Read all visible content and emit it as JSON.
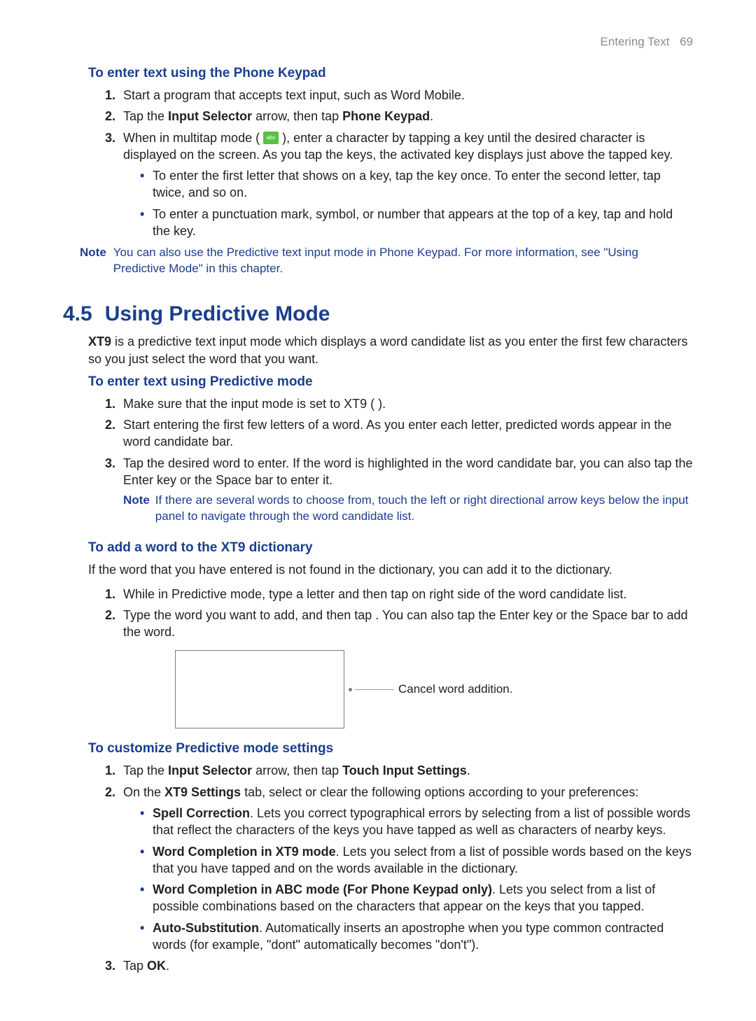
{
  "running_head": {
    "section": "Entering Text",
    "page": "69"
  },
  "sec_phone_keypad": {
    "heading": "To enter text using the Phone Keypad",
    "steps": {
      "s1": "Start a program that accepts text input, such as Word Mobile.",
      "s2_pre": "Tap the ",
      "s2_b1": "Input Selector",
      "s2_mid": " arrow, then tap ",
      "s2_b2": "Phone Keypad",
      "s2_post": ".",
      "s3_pre": "When in multitap mode ( ",
      "s3_post": " ), enter a character by tapping a key until the desired character is displayed on the screen. As you tap the keys, the activated key displays just above the tapped key.",
      "s3_bullets": {
        "b1": "To enter the first letter that shows on a key, tap the key once. To enter the second letter, tap twice, and so on.",
        "b2": "To enter a punctuation mark, symbol, or number that appears at the top of a key, tap and hold the key."
      }
    },
    "note_label": "Note",
    "note_body": "You can also use the Predictive text input mode in Phone Keypad. For more information, see \"Using Predictive Mode\" in this chapter."
  },
  "h45": {
    "num": "4.5",
    "title": "Using Predictive Mode"
  },
  "predictive_intro_pre": "",
  "predictive_intro_b": "XT9",
  "predictive_intro_post": " is a predictive text input mode which displays a word candidate list as you enter the first few characters so you just select the word that you want.",
  "sec_predictive_enter": {
    "heading": "To enter text using Predictive mode",
    "s1": "Make sure that the input mode is set to XT9 (        ).",
    "s2": "Start entering the first few letters of a word. As you enter each letter, predicted words appear in the word candidate bar.",
    "s3": "Tap the desired word to enter. If the word is highlighted in the word candidate bar, you can also tap the Enter key or the Space bar to enter it.",
    "note_label": "Note",
    "note_body": "If there are several words to choose from, touch the left or right directional arrow keys below the input panel to navigate through the word candidate list."
  },
  "sec_add_word": {
    "heading": "To add a word to the XT9 dictionary",
    "intro": "If the word that you have entered is not found in the dictionary, you can add it to the dictionary.",
    "s1": "While in Predictive mode, type a letter and then tap       on right side of the word candidate list.",
    "s2": "Type the word you want to add, and then tap      . You can also tap the Enter key or the Space bar to add the word.",
    "callout": "Cancel word addition."
  },
  "sec_customize": {
    "heading": "To customize Predictive mode settings",
    "s1_pre": "Tap the ",
    "s1_b1": "Input Selector",
    "s1_mid": " arrow, then tap ",
    "s1_b2": "Touch Input Settings",
    "s1_post": ".",
    "s2_pre": "On the ",
    "s2_b": "XT9 Settings",
    "s2_post": " tab, select or clear the following options according to your preferences:",
    "bullets": {
      "b1_b": "Spell Correction",
      "b1_t": ". Lets you correct typographical errors by selecting from a list of possible words that reflect the characters of the keys you have tapped as well as characters of nearby keys.",
      "b2_b": "Word Completion in XT9 mode",
      "b2_t": ". Lets you select from a list of possible words based on the keys that you have tapped and on the words available in the dictionary.",
      "b3_b": "Word Completion in ABC mode (For Phone Keypad only)",
      "b3_t": ". Lets you select from a list of possible combinations based on the characters that appear on the keys that you tapped.",
      "b4_b": "Auto-Substitution",
      "b4_t": ". Automatically inserts an apostrophe when you type common contracted words (for example, \"dont\" automatically becomes \"don't\")."
    },
    "s3_pre": "Tap ",
    "s3_b": "OK",
    "s3_post": "."
  }
}
